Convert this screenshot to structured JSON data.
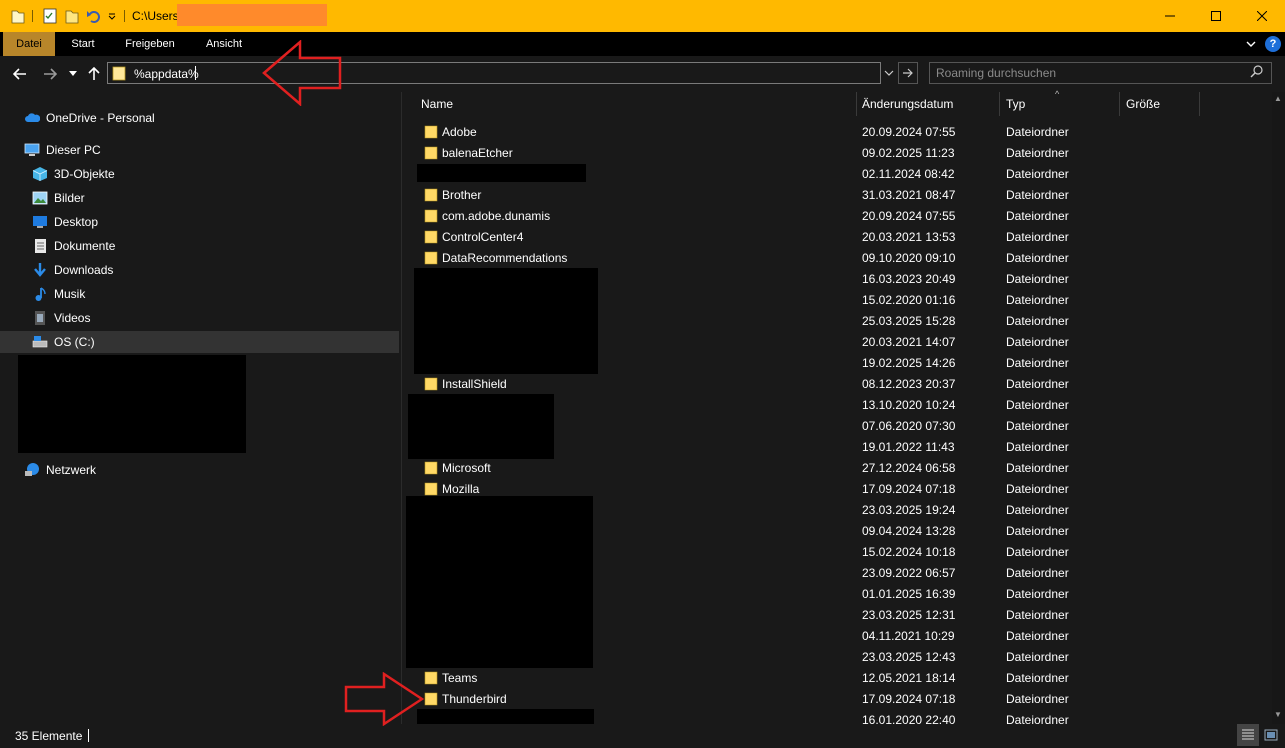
{
  "window": {
    "title_path": "C:\\Users\\"
  },
  "ribbon": {
    "tabs": [
      "Datei",
      "Start",
      "Freigeben",
      "Ansicht"
    ]
  },
  "address": {
    "value": "%appdata%"
  },
  "search": {
    "placeholder": "Roaming durchsuchen"
  },
  "navpane": {
    "onedrive": "OneDrive - Personal",
    "this_pc": "Dieser PC",
    "items": [
      "3D-Objekte",
      "Bilder",
      "Desktop",
      "Dokumente",
      "Downloads",
      "Musik",
      "Videos",
      "OS (C:)"
    ],
    "network": "Netzwerk"
  },
  "columns": {
    "name": "Name",
    "date": "Änderungsdatum",
    "type": "Typ",
    "size": "Größe"
  },
  "rows": [
    {
      "name": "Adobe",
      "date": "20.09.2024 07:55",
      "type": "Dateiordner"
    },
    {
      "name": "balenaEtcher",
      "date": "09.02.2025 11:23",
      "type": "Dateiordner"
    },
    {
      "name": "",
      "date": "02.11.2024 08:42",
      "type": "Dateiordner"
    },
    {
      "name": "Brother",
      "date": "31.03.2021 08:47",
      "type": "Dateiordner"
    },
    {
      "name": "com.adobe.dunamis",
      "date": "20.09.2024 07:55",
      "type": "Dateiordner"
    },
    {
      "name": "ControlCenter4",
      "date": "20.03.2021 13:53",
      "type": "Dateiordner"
    },
    {
      "name": "DataRecommendations",
      "date": "09.10.2020 09:10",
      "type": "Dateiordner"
    },
    {
      "name": "",
      "date": "16.03.2023 20:49",
      "type": "Dateiordner"
    },
    {
      "name": "",
      "date": "15.02.2020 01:16",
      "type": "Dateiordner"
    },
    {
      "name": "",
      "date": "25.03.2025 15:28",
      "type": "Dateiordner"
    },
    {
      "name": "",
      "date": "20.03.2021 14:07",
      "type": "Dateiordner"
    },
    {
      "name": "",
      "date": "19.02.2025 14:26",
      "type": "Dateiordner"
    },
    {
      "name": "InstallShield",
      "date": "08.12.2023 20:37",
      "type": "Dateiordner"
    },
    {
      "name": "",
      "date": "13.10.2020 10:24",
      "type": "Dateiordner"
    },
    {
      "name": "",
      "date": "07.06.2020 07:30",
      "type": "Dateiordner"
    },
    {
      "name": "",
      "date": "19.01.2022 11:43",
      "type": "Dateiordner"
    },
    {
      "name": "Microsoft",
      "date": "27.12.2024 06:58",
      "type": "Dateiordner"
    },
    {
      "name": "Mozilla",
      "date": "17.09.2024 07:18",
      "type": "Dateiordner"
    },
    {
      "name": "",
      "date": "23.03.2025 19:24",
      "type": "Dateiordner"
    },
    {
      "name": "",
      "date": "09.04.2024 13:28",
      "type": "Dateiordner"
    },
    {
      "name": "",
      "date": "15.02.2024 10:18",
      "type": "Dateiordner"
    },
    {
      "name": "",
      "date": "23.09.2022 06:57",
      "type": "Dateiordner"
    },
    {
      "name": "",
      "date": "01.01.2025 16:39",
      "type": "Dateiordner"
    },
    {
      "name": "",
      "date": "23.03.2025 12:31",
      "type": "Dateiordner"
    },
    {
      "name": "",
      "date": "04.11.2021 10:29",
      "type": "Dateiordner"
    },
    {
      "name": "",
      "date": "23.03.2025 12:43",
      "type": "Dateiordner"
    },
    {
      "name": "Teams",
      "date": "12.05.2021 18:14",
      "type": "Dateiordner"
    },
    {
      "name": "Thunderbird",
      "date": "17.09.2024 07:18",
      "type": "Dateiordner"
    },
    {
      "name": "",
      "date": "16.01.2020 22:40",
      "type": "Dateiordner"
    }
  ],
  "status": {
    "count": "35 Elemente"
  },
  "colors": {
    "titlebar": "#ffb900",
    "active_tab": "#b8862a",
    "background": "#191919",
    "folder": "#ffd966",
    "annotation": "#e02020"
  }
}
